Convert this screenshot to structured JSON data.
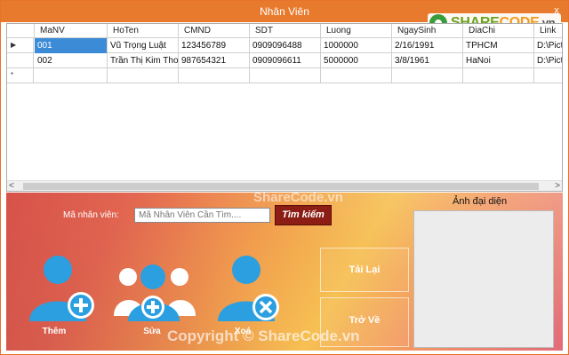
{
  "window": {
    "title": "Nhân Viên",
    "close_label": "x"
  },
  "logo": {
    "part1": "SHARE",
    "part2": "CODE",
    "suffix": ".vn"
  },
  "grid": {
    "columns": [
      "MaNV",
      "HoTen",
      "CMND",
      "SDT",
      "Luong",
      "NgaySinh",
      "DiaChi",
      "Link"
    ],
    "rows": [
      [
        "001",
        "Vũ Trọng Luật",
        "123456789",
        "0909096488",
        "1000000",
        "2/16/1991",
        "TPHCM",
        "D:\\Pictu"
      ],
      [
        "002",
        "Trần Thị Kim Thoa",
        "987654321",
        "0909096611",
        "5000000",
        "3/8/1961",
        "HaNoi",
        "D:\\Pictu"
      ]
    ],
    "selected_row_marker": "▶",
    "new_row_marker": "*",
    "scroll_left": "<",
    "scroll_right": ">"
  },
  "form": {
    "employee_id_label": "Mã nhân viên:",
    "search_placeholder": "Mã Nhân Viên Cần Tìm....",
    "search_button": "Tìm kiếm",
    "add_label": "Thêm",
    "edit_label": "Sửa",
    "delete_label": "Xoá",
    "reload_button": "Tải Lại",
    "back_button": "Trở Về",
    "avatar_label": "Ảnh đại diện"
  },
  "watermarks": {
    "center": "ShareCode.vn",
    "bottom": "Copyright © ShareCode.vn"
  },
  "colors": {
    "titlebar": "#e87a2e",
    "selection": "#3c8bd6",
    "search_button": "#8b1d14",
    "user_icon": "#2b9fe0"
  },
  "icons": {
    "add": "user-add-icon",
    "edit": "users-edit-icon",
    "delete": "user-delete-icon"
  }
}
